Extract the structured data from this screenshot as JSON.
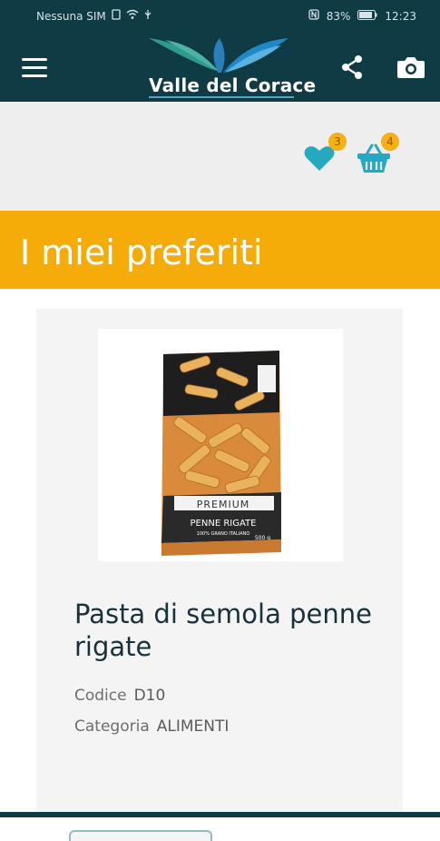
{
  "status_bar": {
    "carrier": "Nessuna SIM",
    "battery": "83%",
    "time": "12:23"
  },
  "app_bar": {
    "logo_text": "Valle del Corace",
    "icons": {
      "menu": "menu-icon",
      "share": "share-icon",
      "camera": "camera-icon"
    }
  },
  "toolbar": {
    "favorites_count": "3",
    "cart_count": "4"
  },
  "page": {
    "title": "I miei preferiti"
  },
  "product": {
    "name": "Pasta di semola penne rigate",
    "code_label": "Codice",
    "code_value": "D10",
    "category_label": "Categoria",
    "category_value": "ALIMENTI",
    "package": {
      "brand_line": "PREMIUM",
      "product_line": "PENNE RIGATE",
      "sub_line": "100% GRANO ITALIANO",
      "weight": "500 g"
    }
  },
  "colors": {
    "primary_dark": "#0f3b44",
    "accent_teal": "#24a9c1",
    "banner_orange": "#f6ac08",
    "badge_orange": "#f5b014"
  }
}
